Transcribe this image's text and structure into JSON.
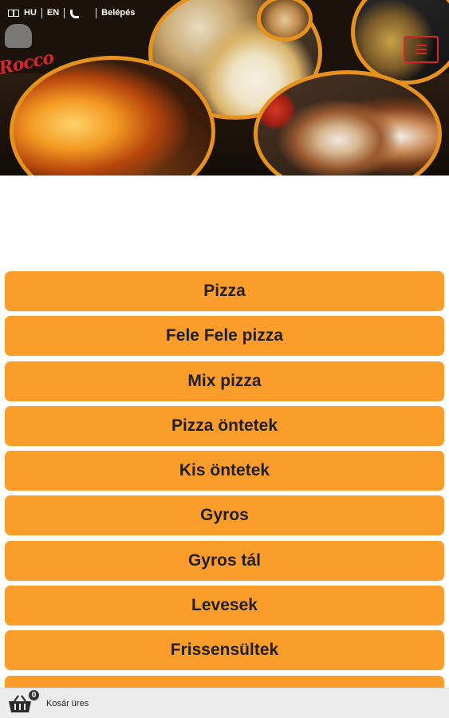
{
  "header": {
    "lang_hu": "HU",
    "lang_en": "EN",
    "login_label": "Belépés",
    "logo_text": "Rocco"
  },
  "categories": [
    "Pizza",
    "Fele Fele pizza",
    "Mix pizza",
    "Pizza öntetek",
    "Kis öntetek",
    "Gyros",
    "Gyros tál",
    "Levesek",
    "Frissensültek",
    ""
  ],
  "cart": {
    "count": "0",
    "label": "Kosár üres"
  },
  "colors": {
    "category_bg": "#fb9d2b",
    "accent_red": "#d7262b",
    "photo_border": "#e7921e"
  }
}
